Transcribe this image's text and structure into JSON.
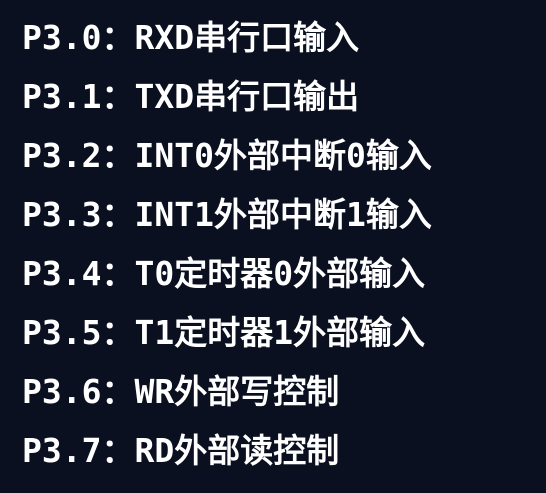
{
  "document": {
    "lines": [
      {
        "pin": "P3.0",
        "separator": "：",
        "description": "RXD串行口输入"
      },
      {
        "pin": "P3.1",
        "separator": "：",
        "description": "TXD串行口输出"
      },
      {
        "pin": "P3.2",
        "separator": "：",
        "description": "INT0外部中断0输入"
      },
      {
        "pin": "P3.3",
        "separator": "：",
        "description": "INT1外部中断1输入"
      },
      {
        "pin": "P3.4",
        "separator": "：",
        "description": "T0定时器0外部输入"
      },
      {
        "pin": "P3.5",
        "separator": "：",
        "description": "T1定时器1外部输入"
      },
      {
        "pin": "P3.6",
        "separator": "：",
        "description": "WR外部写控制"
      },
      {
        "pin": "P3.7",
        "separator": "：",
        "description": "RD外部读控制"
      }
    ]
  },
  "colors": {
    "background": "#0b1020",
    "text": "#ffffff"
  }
}
